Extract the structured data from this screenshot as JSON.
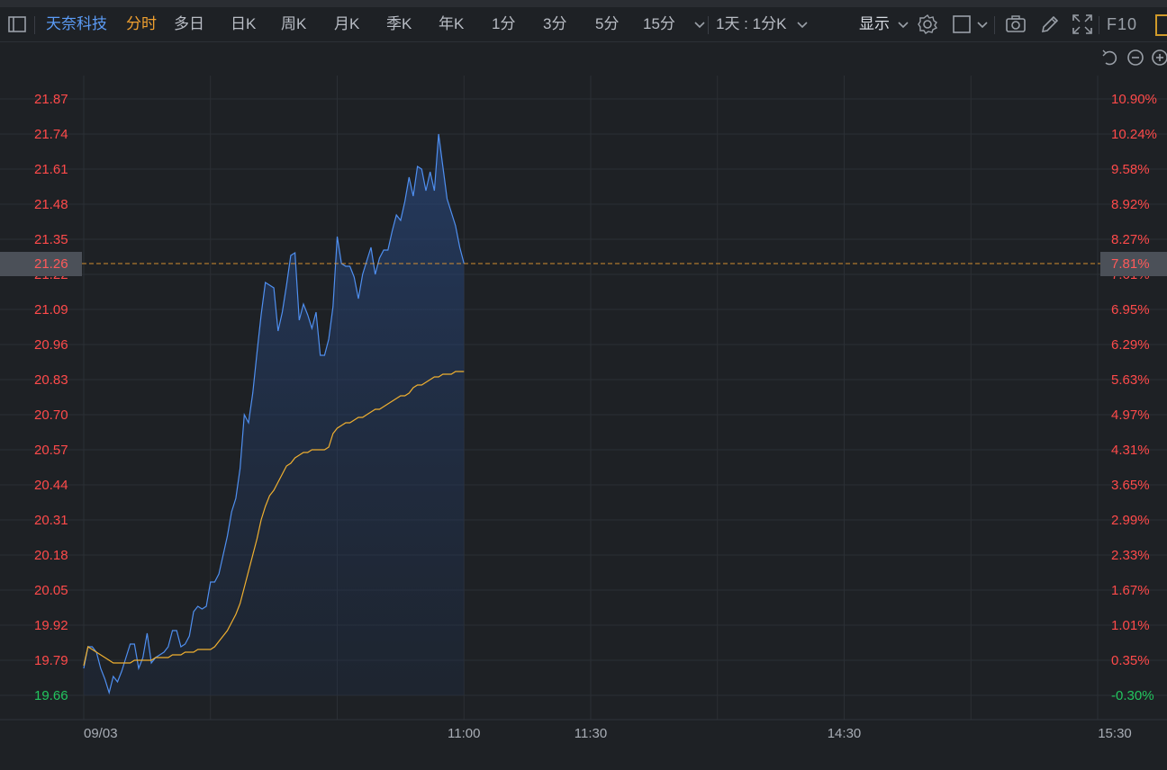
{
  "toolbar": {
    "stock_name": "天奈科技",
    "modes": [
      "分时",
      "多日",
      "日K",
      "周K",
      "月K",
      "季K",
      "年K",
      "1分",
      "3分",
      "5分",
      "15分"
    ],
    "range_label": "1天 : 1分K",
    "display_label": "显示",
    "f10_label": "F10"
  },
  "icons": [
    "sidebar-toggle-icon",
    "chevron-down-icon",
    "gear-icon",
    "square-icon",
    "camera-icon",
    "pencil-icon",
    "fullscreen-icon",
    "undo-icon",
    "zoom-out-icon",
    "zoom-in-icon"
  ],
  "colors": {
    "price_line": "#4f8ff0",
    "avg_line": "#f0b030",
    "up": "#ff4a4a",
    "down": "#22c55e",
    "grid": "#2b2f35",
    "last_price_line": "#f0a030"
  },
  "last_price": "21.26",
  "last_pct": "7.81%",
  "chart_data": {
    "type": "line",
    "date_label": "09/03",
    "x_ticks": [
      "09/03",
      "11:00",
      "11:30",
      "14:30",
      "15:30"
    ],
    "price_labels": [
      "21.87",
      "21.74",
      "21.61",
      "21.48",
      "21.35",
      "21.22",
      "21.09",
      "20.96",
      "20.83",
      "20.70",
      "20.57",
      "20.44",
      "20.31",
      "20.18",
      "20.05",
      "19.92",
      "19.79",
      "19.66"
    ],
    "pct_labels": [
      "10.90%",
      "10.24%",
      "9.58%",
      "8.92%",
      "8.27%",
      "7.61%",
      "6.95%",
      "6.29%",
      "5.63%",
      "4.97%",
      "4.31%",
      "3.65%",
      "2.99%",
      "2.33%",
      "1.67%",
      "1.01%",
      "0.35%",
      "-0.30%"
    ],
    "ylim": [
      19.66,
      21.87
    ],
    "prev_close": 19.72,
    "session_minutes": 241,
    "series": [
      {
        "name": "price",
        "values": [
          19.76,
          19.84,
          19.84,
          19.82,
          19.76,
          19.72,
          19.67,
          19.73,
          19.71,
          19.75,
          19.8,
          19.85,
          19.85,
          19.76,
          19.8,
          19.89,
          19.78,
          19.8,
          19.81,
          19.82,
          19.84,
          19.9,
          19.9,
          19.84,
          19.85,
          19.88,
          19.97,
          19.99,
          19.98,
          19.99,
          20.08,
          20.08,
          20.11,
          20.18,
          20.25,
          20.34,
          20.39,
          20.5,
          20.7,
          20.67,
          20.78,
          20.93,
          21.07,
          21.19,
          21.18,
          21.17,
          21.01,
          21.08,
          21.18,
          21.29,
          21.3,
          21.05,
          21.11,
          21.07,
          21.02,
          21.08,
          20.92,
          20.92,
          20.98,
          21.1,
          21.36,
          21.26,
          21.25,
          21.25,
          21.21,
          21.13,
          21.22,
          21.27,
          21.32,
          21.22,
          21.28,
          21.31,
          21.31,
          21.38,
          21.44,
          21.42,
          21.49,
          21.58,
          21.51,
          21.62,
          21.61,
          21.53,
          21.6,
          21.53,
          21.74,
          21.62,
          21.5,
          21.45,
          21.4,
          21.32,
          21.26
        ],
        "start_minute": 0
      },
      {
        "name": "avg",
        "values": [
          19.77,
          19.84,
          19.83,
          19.82,
          19.81,
          19.8,
          19.79,
          19.78,
          19.78,
          19.78,
          19.78,
          19.78,
          19.79,
          19.79,
          19.79,
          19.79,
          19.79,
          19.8,
          19.8,
          19.8,
          19.8,
          19.81,
          19.81,
          19.81,
          19.82,
          19.82,
          19.82,
          19.83,
          19.83,
          19.83,
          19.83,
          19.84,
          19.86,
          19.88,
          19.9,
          19.93,
          19.96,
          20.0,
          20.06,
          20.12,
          20.18,
          20.24,
          20.31,
          20.36,
          20.4,
          20.42,
          20.45,
          20.48,
          20.51,
          20.52,
          20.54,
          20.55,
          20.56,
          20.56,
          20.57,
          20.57,
          20.57,
          20.57,
          20.58,
          20.63,
          20.65,
          20.66,
          20.67,
          20.67,
          20.68,
          20.69,
          20.69,
          20.7,
          20.71,
          20.72,
          20.72,
          20.73,
          20.74,
          20.75,
          20.76,
          20.77,
          20.77,
          20.78,
          20.8,
          20.81,
          20.81,
          20.82,
          20.83,
          20.84,
          20.84,
          20.85,
          20.85,
          20.85,
          20.86,
          20.86,
          20.86
        ],
        "start_minute": 0
      }
    ],
    "grid": true
  }
}
